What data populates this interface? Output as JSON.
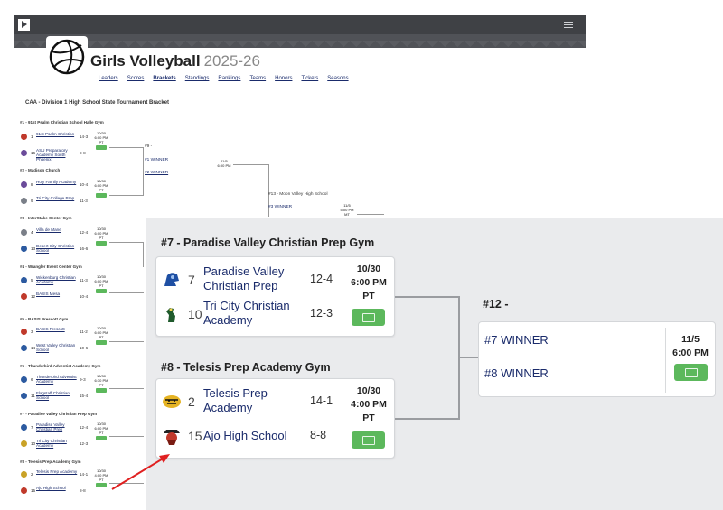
{
  "app": {
    "title": "Girls Volleyball",
    "season": "2025-26"
  },
  "nav": [
    "Leaders",
    "Scores",
    "Brackets",
    "Standings",
    "Rankings",
    "Teams",
    "Honors",
    "Tickets",
    "Seasons"
  ],
  "nav_active": "Brackets",
  "bracket_title": "CAA - Division 1 High School State Tournament Bracket",
  "games": [
    {
      "gym": "#1 - 91st Psalm Christian School Halle Gym",
      "teams": [
        {
          "seed": "1",
          "name": "91st Psalm Christian",
          "record": "14-3",
          "icon": "eagle-logo-icon"
        },
        {
          "seed": "16",
          "name": "ASU Preparatory Academy South Phoenix",
          "record": "8-8",
          "icon": "sundevil-logo-icon"
        }
      ],
      "date": "10/30",
      "time": "6:00 PM",
      "tz": "PT"
    },
    {
      "gym": "#2 - Madison Church",
      "teams": [
        {
          "seed": "8",
          "name": "Holy Family Academy",
          "record": "10-4",
          "icon": "family-logo-icon"
        },
        {
          "seed": "9",
          "name": "Tri City College Prep",
          "record": "11-3",
          "icon": "knight-logo-icon"
        }
      ],
      "date": "10/30",
      "time": "6:00 PM",
      "tz": "PT"
    },
    {
      "gym": "#3 - InterStake Center Gym",
      "teams": [
        {
          "seed": "4",
          "name": "Villa de Mane",
          "record": "12-4",
          "icon": "crest-logo-icon"
        },
        {
          "seed": "13",
          "name": "Desert City Christian School",
          "record": "16-6",
          "icon": "cross-logo-icon"
        }
      ],
      "date": "10/30",
      "time": "6:00 PM",
      "tz": "PT"
    },
    {
      "gym": "#4 - Wrangler Event Center Gym",
      "teams": [
        {
          "seed": "5",
          "name": "Wickenburg Christian Academy",
          "record": "11-3",
          "icon": "wrangler-logo-icon"
        },
        {
          "seed": "12",
          "name": "BASIS Mesa",
          "record": "10-4",
          "icon": "basis-logo-icon"
        }
      ],
      "date": "10/30",
      "time": "6:00 PM",
      "tz": "PT"
    },
    {
      "gym": "#5 - BASIS Prescott Gym",
      "teams": [
        {
          "seed": "3",
          "name": "BASIS Prescott",
          "record": "11-2",
          "icon": "basis-logo-icon"
        },
        {
          "seed": "14",
          "name": "West Valley Christian School",
          "record": "10-6",
          "icon": "valley-logo-icon"
        }
      ],
      "date": "10/30",
      "time": "6:00 PM",
      "tz": "PT"
    },
    {
      "gym": "#6 - Thunderbird Adventist Academy Gym",
      "teams": [
        {
          "seed": "6",
          "name": "Thunderbird Adventist Academy",
          "record": "9-3",
          "icon": "thunderbird-logo-icon"
        },
        {
          "seed": "11",
          "name": "Flagstaff Christian School",
          "record": "15-4",
          "icon": "flag-logo-icon"
        }
      ],
      "date": "10/30",
      "time": "6:30 PM",
      "tz": "PT"
    },
    {
      "gym": "#7 - Paradise Valley Christian Prep Gym",
      "teams": [
        {
          "seed": "7",
          "name": "Paradise Valley Christian Prep",
          "record": "12-4",
          "icon": "trojan-logo-icon"
        },
        {
          "seed": "10",
          "name": "Tri City Christian Academy",
          "record": "12-3",
          "icon": "eagle-logo-icon"
        }
      ],
      "date": "10/30",
      "time": "6:00 PM",
      "tz": "PT"
    },
    {
      "gym": "#8 - Telesis Prep Academy Gym",
      "teams": [
        {
          "seed": "2",
          "name": "Telesis Prep Academy",
          "record": "14-1",
          "icon": "tiger-logo-icon"
        },
        {
          "seed": "15",
          "name": "Ajo High School",
          "record": "8-8",
          "icon": "raider-logo-icon"
        }
      ],
      "date": "10/30",
      "time": "4:00 PM",
      "tz": "PT"
    }
  ],
  "round2": [
    {
      "label": "#9 -",
      "winners": [
        "#1 WINNER",
        "#2 WINNER"
      ],
      "date": "11/5",
      "time": "6:00 PM"
    },
    {
      "label": "#13 - Moon Valley High School",
      "winners": [
        "#3 WINNER"
      ],
      "date": "11/5",
      "time": "5:00 PM",
      "tz": "MT"
    },
    {
      "label": "#12 -",
      "winners": [
        "#7 WINNER",
        "#8 WINNER"
      ],
      "date": "11/5",
      "time": "6:00 PM"
    }
  ],
  "colors": {
    "accent_green": "#5cb85c",
    "link_navy": "#1a2b6b",
    "arrow_red": "#e02020",
    "header_gray": "#505257"
  }
}
